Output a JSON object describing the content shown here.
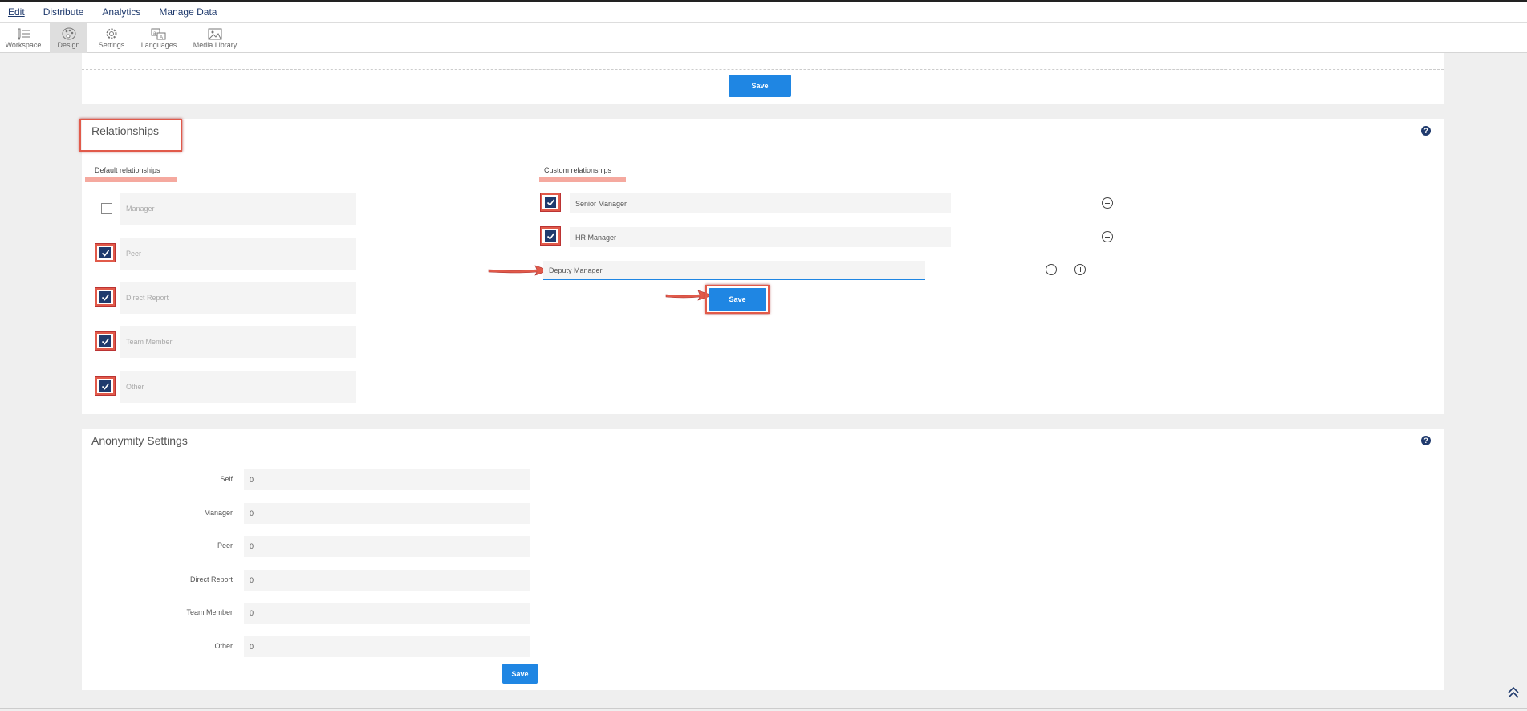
{
  "topnav": {
    "items": [
      "Edit",
      "Distribute",
      "Analytics",
      "Manage Data"
    ]
  },
  "toolbar": {
    "items": [
      "Workspace",
      "Design",
      "Settings",
      "Languages",
      "Media Library"
    ]
  },
  "top_save": "Save",
  "relationships": {
    "title": "Relationships",
    "help": "?",
    "default_label": "Default relationships",
    "custom_label": "Custom relationships",
    "defaults": [
      {
        "label": "Manager",
        "checked": false
      },
      {
        "label": "Peer",
        "checked": true
      },
      {
        "label": "Direct Report",
        "checked": true
      },
      {
        "label": "Team Member",
        "checked": true
      },
      {
        "label": "Other",
        "checked": true
      }
    ],
    "customs": [
      {
        "label": "Senior Manager",
        "checked": true
      },
      {
        "label": "HR Manager",
        "checked": true
      }
    ],
    "new_input_value": "Deputy Manager",
    "save": "Save"
  },
  "anonymity": {
    "title": "Anonymity Settings",
    "help": "?",
    "rows": [
      {
        "label": "Self",
        "value": "0"
      },
      {
        "label": "Manager",
        "value": "0"
      },
      {
        "label": "Peer",
        "value": "0"
      },
      {
        "label": "Direct Report",
        "value": "0"
      },
      {
        "label": "Team Member",
        "value": "0"
      },
      {
        "label": "Other",
        "value": "0"
      }
    ],
    "save": "Save"
  },
  "colors": {
    "accent": "#1f86e3",
    "nav": "#1f3a6d",
    "annotation": "#e15a4a"
  }
}
